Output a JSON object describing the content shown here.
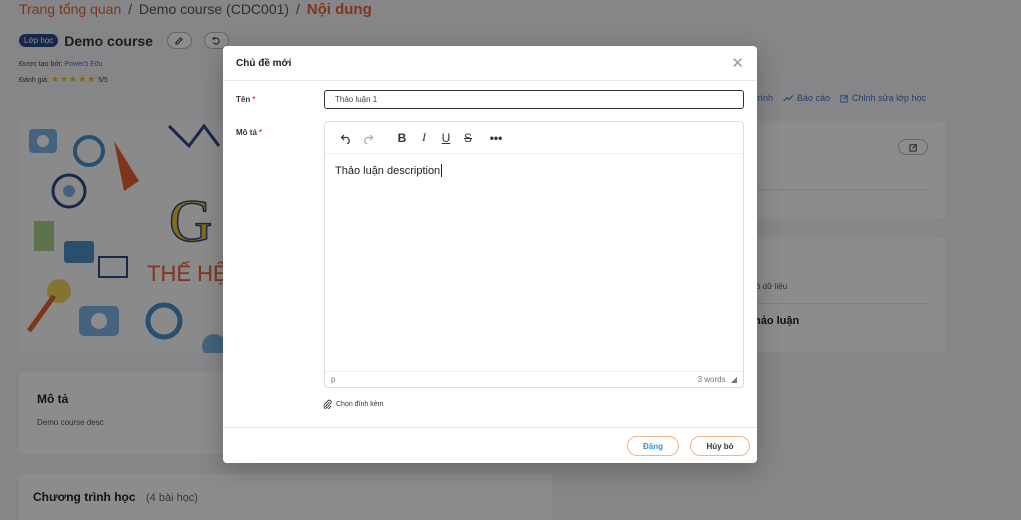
{
  "breadcrumb": {
    "home": "Trang tổng quan",
    "course": "Demo course (CDC001)",
    "current": "Nội dung",
    "sep": "/"
  },
  "course": {
    "badge": "Lớp học",
    "title": "Demo course",
    "created_by_label": "Được tạo bởi:",
    "created_by": "Power5 Edu",
    "rating_label": "Đánh giá:",
    "stars": "★★★★★",
    "rating": "5/5"
  },
  "actions": {
    "program": "trình",
    "report": "Báo cáo",
    "edit_class": "Chỉnh sửa lớp học"
  },
  "image": {
    "text1": "G",
    "text2": "THẾ HỆ Đ"
  },
  "right": {
    "no_data": "ó dữ liệu",
    "discussion": "hảo luận"
  },
  "description": {
    "title": "Mô tả",
    "body": "Demo course desc"
  },
  "program": {
    "title": "Chương trình học",
    "count": "(4 bài học)"
  },
  "modal": {
    "title": "Chủ đề mới",
    "name_label": "Tên",
    "name_value": "Thảo luận 1",
    "desc_label": "Mô tả",
    "required_mark": "*",
    "editor_content": "Thảo luận description",
    "path": "p",
    "word_count": "3 words",
    "attach_label": "Chọn đính kèm",
    "post_button": "Đăng",
    "cancel_button": "Hủy bỏ"
  },
  "colors": {
    "accent": "#e8622f",
    "link": "#3a78c9",
    "badge": "#2d4a8a",
    "required": "#e54848"
  }
}
